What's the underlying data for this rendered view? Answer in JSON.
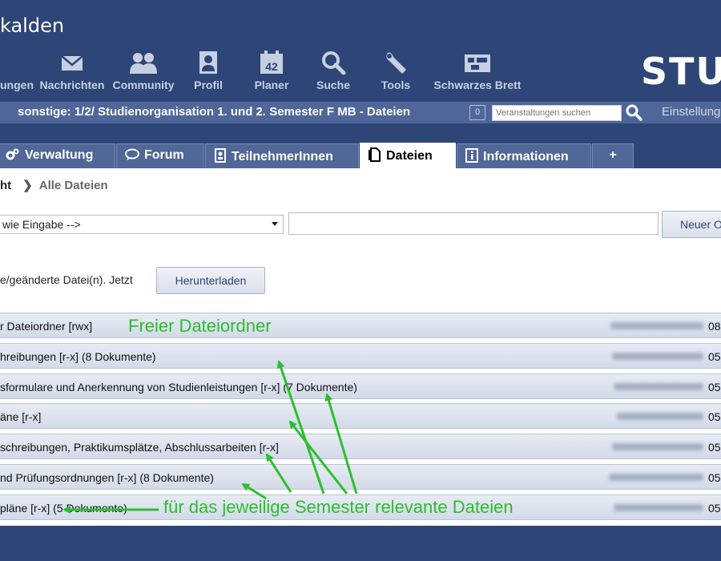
{
  "header": {
    "site_title": "kalden",
    "logo_text": "STU",
    "nav": [
      {
        "label": "ungen",
        "icon": "courses-icon"
      },
      {
        "label": "Nachrichten",
        "icon": "envelope-icon"
      },
      {
        "label": "Community",
        "icon": "people-icon"
      },
      {
        "label": "Profil",
        "icon": "profile-icon"
      },
      {
        "label": "Planer",
        "icon": "calendar-icon",
        "badge": "42"
      },
      {
        "label": "Suche",
        "icon": "magnifier-icon"
      },
      {
        "label": "Tools",
        "icon": "wrench-icon"
      },
      {
        "label": "Schwarzes Brett",
        "icon": "board-icon"
      }
    ]
  },
  "context_bar": {
    "title": "sonstige: 1/2/ Studienorganisation 1. und 2. Semester F MB - Dateien",
    "counter": "0",
    "search_placeholder": "Veranstaltungen suchen",
    "settings_label": "Einstellung"
  },
  "tabs": [
    {
      "label": "Verwaltung",
      "icon": "gears-icon",
      "active": false
    },
    {
      "label": "Forum",
      "icon": "speech-bubble-icon",
      "active": false
    },
    {
      "label": "TeilnehmerInnen",
      "icon": "participants-icon",
      "active": false
    },
    {
      "label": "Dateien",
      "icon": "document-icon",
      "active": true
    },
    {
      "label": "Informationen",
      "icon": "info-icon",
      "active": false
    },
    {
      "label": "+",
      "icon": "",
      "active": false
    }
  ],
  "breadcrumb": {
    "first": "ht",
    "separator": "❯",
    "current": "Alle Dateien"
  },
  "toolbar": {
    "select_value": "wie Eingabe -->",
    "new_button": "Neuer O"
  },
  "download": {
    "text": "e/geänderte Datei(n). Jetzt",
    "button": "Herunterladen"
  },
  "folders": [
    {
      "name": "r Dateiordner [rwx]",
      "date": "08"
    },
    {
      "name": "hreibungen [r-x]  (8 Dokumente)",
      "date": "05"
    },
    {
      "name": "sformulare und Anerkennung von Studienleistungen [r-x]  (7 Dokumente)",
      "date": "05"
    },
    {
      "name": "äne [r-x]",
      "date": "05"
    },
    {
      "name": "schreibungen, Praktikumsplätze, Abschlussarbeiten [r-x]",
      "date": "05"
    },
    {
      "name": "nd Prüfungsordnungen [r-x]  (8 Dokumente)",
      "date": "05"
    },
    {
      "name": "pläne [r-x]  (5 Dokumente)",
      "date": "05"
    }
  ],
  "annotations": {
    "free_folder": "Freier Dateiordner",
    "semester_files": "für das jeweilige Semester relevante Dateien",
    "color": "#2bbf2b"
  },
  "colors": {
    "header_bg": "#2d4577",
    "context_bar_bg": "#4e6699",
    "tab_bg": "#506797",
    "row_bg": "#dde3ee"
  }
}
